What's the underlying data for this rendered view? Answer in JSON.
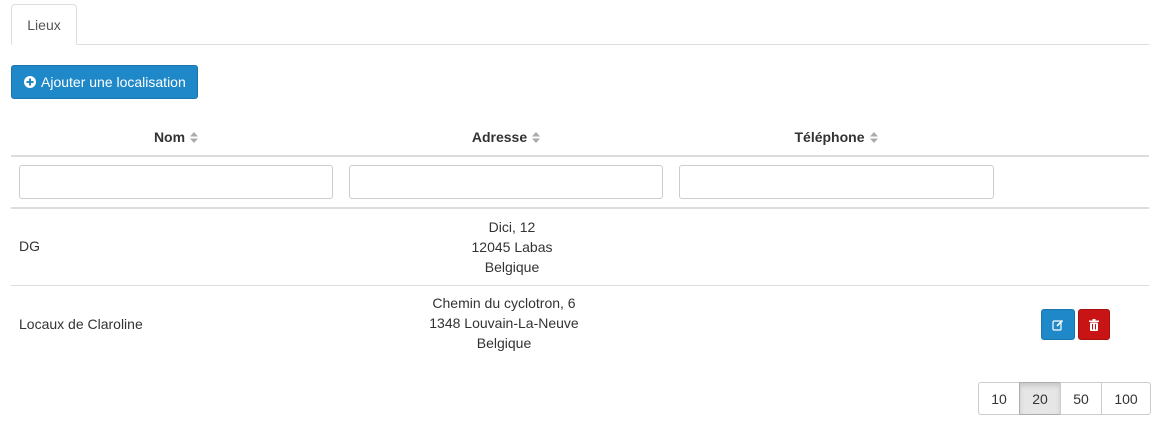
{
  "tabs": [
    {
      "label": "Lieux"
    }
  ],
  "toolbar": {
    "add_label": "Ajouter une localisation"
  },
  "table": {
    "headers": [
      "Nom",
      "Adresse",
      "Téléphone"
    ],
    "filters": [
      {
        "value": "",
        "placeholder": ""
      },
      {
        "value": "",
        "placeholder": ""
      },
      {
        "value": "",
        "placeholder": ""
      }
    ],
    "rows": [
      {
        "nom": "DG",
        "address": [
          "Dici, 12",
          "12045 Labas",
          "Belgique"
        ],
        "phone": ""
      },
      {
        "nom": "Locaux de Claroline",
        "address": [
          "Chemin du cyclotron, 6",
          "1348 Louvain-La-Neuve",
          "Belgique"
        ],
        "phone": ""
      }
    ]
  },
  "pagination": {
    "options": [
      "10",
      "20",
      "50",
      "100"
    ],
    "selected": "20"
  },
  "colors": {
    "primary": "#1e88c8",
    "danger": "#c81414",
    "border": "#dddddd"
  },
  "icons": {
    "add": "plus-circle-icon",
    "sort": "sort-icon",
    "edit": "edit-icon",
    "delete": "trash-icon"
  }
}
